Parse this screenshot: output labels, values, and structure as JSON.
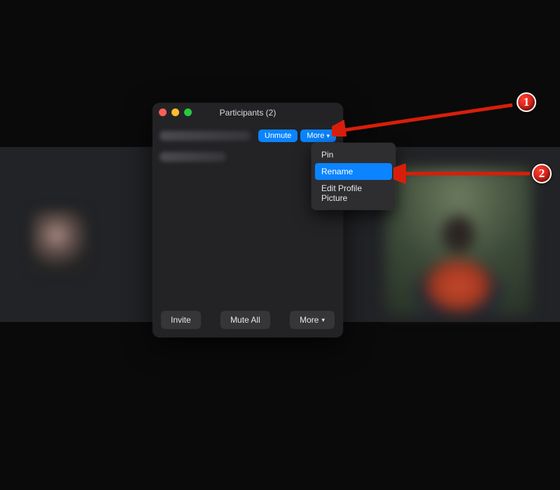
{
  "panel": {
    "title": "Participants (2)",
    "row_actions": {
      "unmute_label": "Unmute",
      "more_label": "More"
    },
    "bottom_bar": {
      "invite_label": "Invite",
      "mute_all_label": "Mute All",
      "more_label": "More"
    }
  },
  "more_menu": {
    "items": [
      {
        "label": "Pin",
        "highlight": false
      },
      {
        "label": "Rename",
        "highlight": true
      },
      {
        "label": "Edit Profile Picture",
        "highlight": false
      }
    ]
  },
  "annotations": {
    "badge_1": "1",
    "badge_2": "2"
  },
  "colors": {
    "accent": "#0a84ff",
    "panel_bg": "#232326",
    "menu_bg": "#2e2e31",
    "annotation_red": "#d81e0a"
  }
}
